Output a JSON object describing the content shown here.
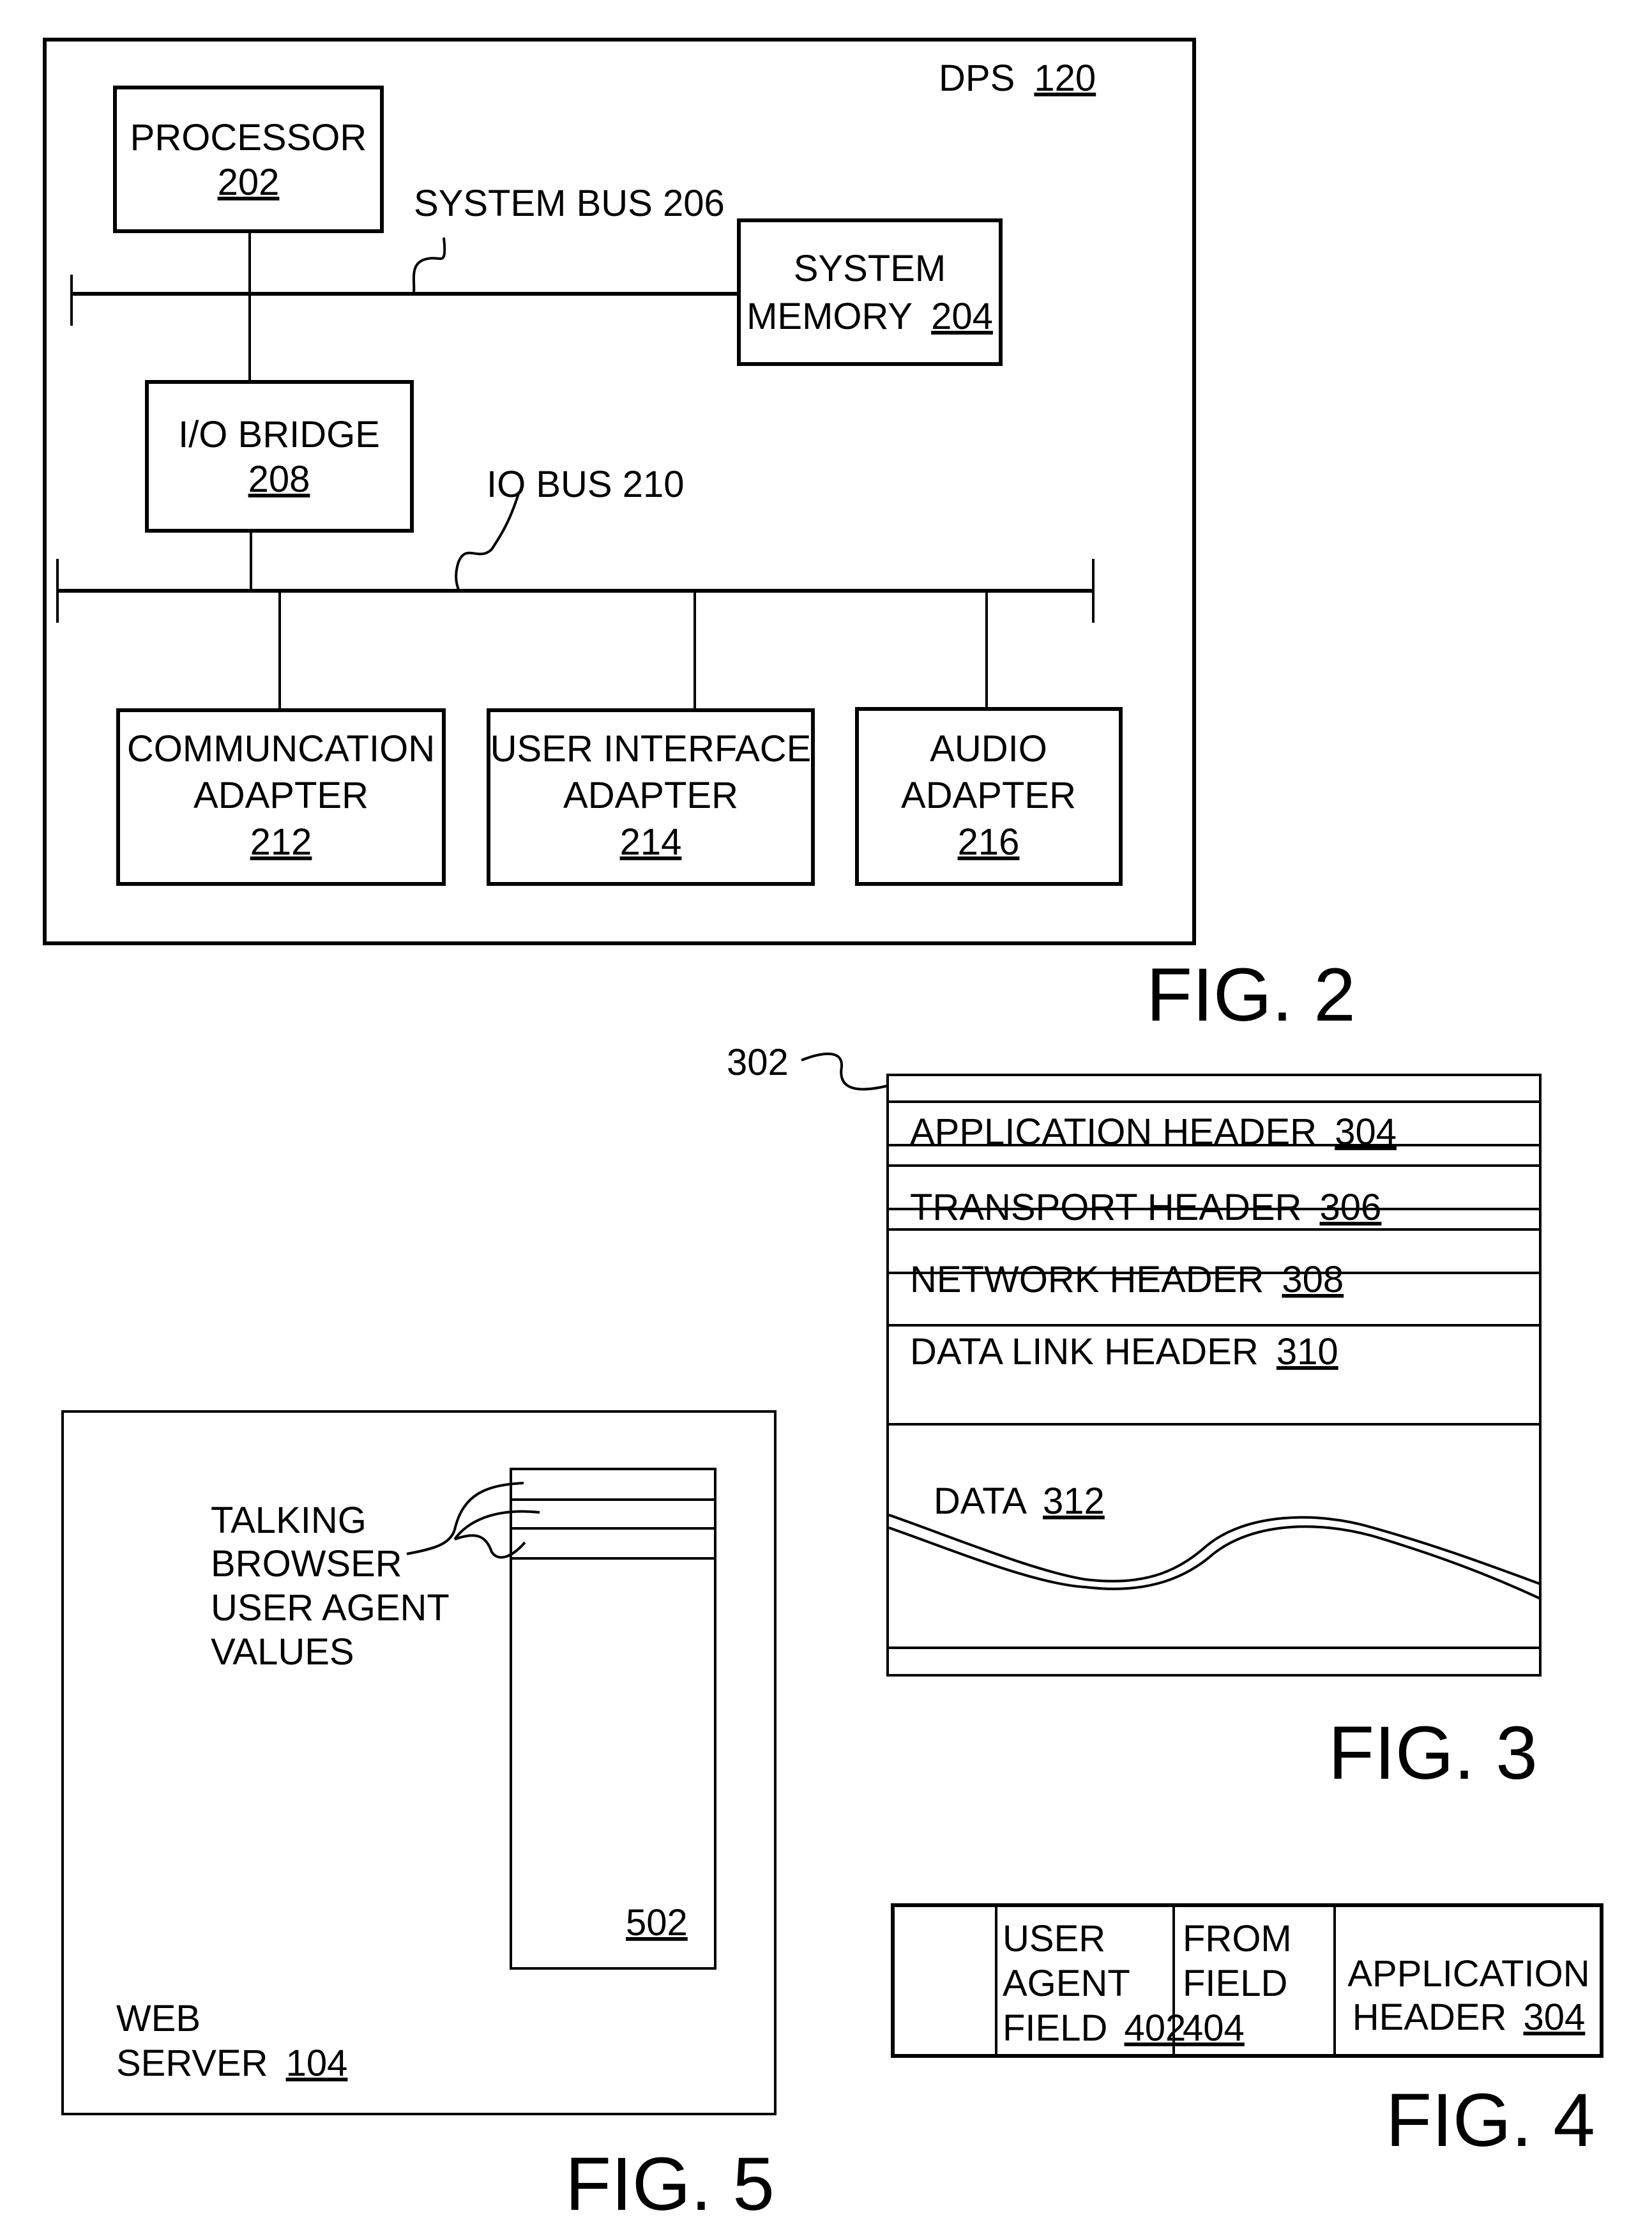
{
  "fig2": {
    "caption": "FIG. 2",
    "container": {
      "name": "DPS",
      "ref": "120"
    },
    "processor": {
      "lines": [
        "PROCESSOR"
      ],
      "ref": "202"
    },
    "system_bus": {
      "label": "SYSTEM BUS 206"
    },
    "system_memory": {
      "lines": [
        "SYSTEM",
        "MEMORY"
      ],
      "ref": "204"
    },
    "io_bridge": {
      "lines": [
        "I/O BRIDGE"
      ],
      "ref": "208"
    },
    "io_bus": {
      "label": "IO BUS 210"
    },
    "adapters": [
      {
        "lines": [
          "COMMUNCATION",
          "ADAPTER"
        ],
        "ref": "212"
      },
      {
        "lines": [
          "USER INTERFACE",
          "ADAPTER"
        ],
        "ref": "214"
      },
      {
        "lines": [
          "AUDIO",
          "ADAPTER"
        ],
        "ref": "216"
      }
    ]
  },
  "fig3": {
    "caption": "FIG. 3",
    "packet_ref": "302",
    "headers": [
      {
        "label": "APPLICATION HEADER",
        "ref": "304"
      },
      {
        "label": "TRANSPORT HEADER",
        "ref": "306"
      },
      {
        "label": "NETWORK HEADER",
        "ref": "308"
      },
      {
        "label": "DATA LINK HEADER",
        "ref": "310"
      }
    ],
    "data": {
      "label": "DATA",
      "ref": "312"
    }
  },
  "fig4": {
    "caption": "FIG. 4",
    "fields": [
      {
        "lines": [
          "USER",
          "AGENT",
          "FIELD"
        ],
        "ref": "402"
      },
      {
        "lines": [
          "FROM",
          "FIELD"
        ],
        "ref": "404"
      },
      {
        "lines": [
          "APPLICATION",
          "HEADER"
        ],
        "ref": "304"
      }
    ]
  },
  "fig5": {
    "caption": "FIG. 5",
    "annotation_lines": [
      "TALKING",
      "BROWSER",
      "USER AGENT",
      "VALUES"
    ],
    "table_ref": "502",
    "server": {
      "lines": [
        "WEB",
        "SERVER"
      ],
      "ref": "104"
    }
  }
}
